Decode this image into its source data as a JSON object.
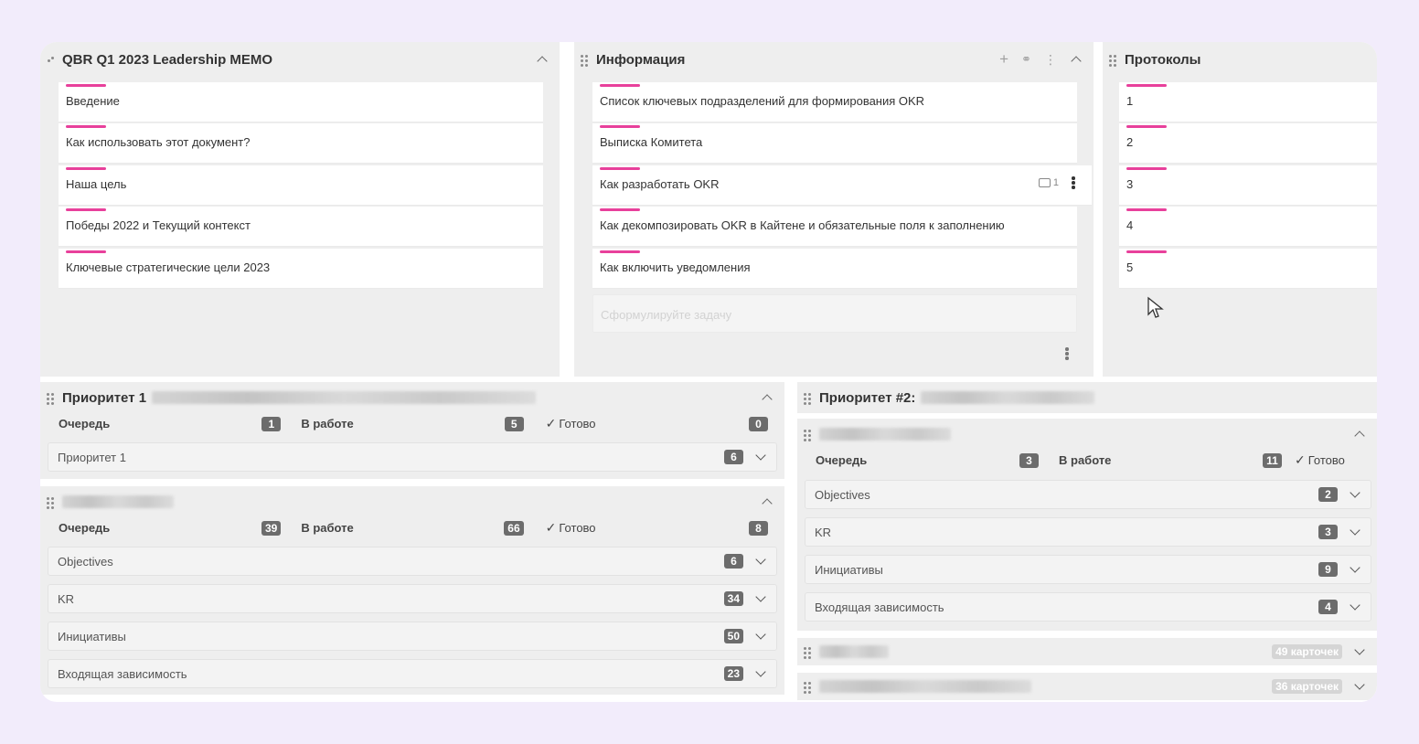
{
  "panels": {
    "memo": {
      "title": "QBR Q1 2023 Leadership MEMO",
      "cards": [
        "Введение",
        "Как использовать этот документ?",
        "Наша цель",
        "Победы 2022 и Текущий контекст",
        "Ключевые стратегические цели 2023"
      ]
    },
    "info": {
      "title": "Информация",
      "cards": [
        "Список ключевых подразделений для формирования OKR",
        "Выписка Комитета",
        "Как разработать OKR",
        "Как декомпозировать OKR в Кайтене и обязательные поля к заполнению",
        "Как включить уведомления"
      ],
      "comment_count": "1",
      "new_task_placeholder": "Сформулируйте задачу"
    },
    "protocols": {
      "title": "Протоколы",
      "cards": [
        "1",
        "2",
        "3",
        "4",
        "5"
      ]
    }
  },
  "boards": {
    "p1": {
      "title": "Приоритет 1",
      "columns": [
        {
          "name": "Очередь",
          "count": "1"
        },
        {
          "name": "В работе",
          "count": "5"
        },
        {
          "name": "Готово",
          "count": "0"
        }
      ],
      "lanes": [
        {
          "name": "Приоритет 1",
          "count": "6"
        }
      ]
    },
    "p1b": {
      "columns": [
        {
          "name": "Очередь",
          "count": "39"
        },
        {
          "name": "В работе",
          "count": "66"
        },
        {
          "name": "Готово",
          "count": "8"
        }
      ],
      "lanes": [
        {
          "name": "Objectives",
          "count": "6"
        },
        {
          "name": "KR",
          "count": "34"
        },
        {
          "name": "Инициативы",
          "count": "50"
        },
        {
          "name": "Входящая зависимость",
          "count": "23"
        }
      ]
    },
    "p2": {
      "title": "Приоритет #2:",
      "columns": [
        {
          "name": "Очередь",
          "count": "3"
        },
        {
          "name": "В работе",
          "count": "11"
        },
        {
          "name": "Готово",
          "count": ""
        }
      ],
      "lanes": [
        {
          "name": "Objectives",
          "count": "2"
        },
        {
          "name": "KR",
          "count": "3"
        },
        {
          "name": "Инициативы",
          "count": "9"
        },
        {
          "name": "Входящая зависимость",
          "count": "4"
        }
      ],
      "collapsed": [
        {
          "count": "49 карточек"
        },
        {
          "count": "36 карточек"
        }
      ]
    }
  },
  "colors": {
    "accent": "#e8409b",
    "background": "#f2ecfb"
  }
}
